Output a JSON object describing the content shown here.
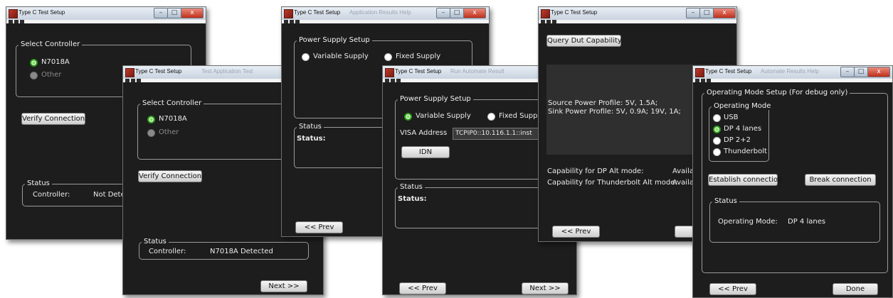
{
  "window_title": "Type C Test Setup",
  "colors": {
    "background": "#1d1d1d",
    "selected_radio": "#2fa51a",
    "titlebar": "#d6dee8"
  },
  "controls": {
    "minimize": "–",
    "maximize": "□",
    "close": "x"
  },
  "w1": {
    "select_legend": "Select Controller",
    "opt_n7018a": "N7018A",
    "opt_other": "Other",
    "verify": "Verify Connection",
    "status_legend": "Status",
    "controller_label": "Controller:",
    "controller_value": "Not Detec"
  },
  "w2": {
    "select_legend": "Select Controller",
    "opt_n7018a": "N7018A",
    "opt_other": "Other",
    "verify": "Verify Connection",
    "status_legend": "Status",
    "controller_label": "Controller:",
    "controller_value": "N7018A Detected",
    "next": "Next >>"
  },
  "w3": {
    "ps_legend": "Power Supply Setup",
    "variable": "Variable Supply",
    "fixed": "Fixed Supply",
    "status_legend": "Status",
    "status_label": "Status:",
    "prev": "<< Prev"
  },
  "w4": {
    "ps_legend": "Power Supply Setup",
    "variable": "Variable Supply",
    "fixed": "Fixed Suppl",
    "visa_label": "VISA Address",
    "visa_value": "TCPIP0::10.116.1.1::inst",
    "idn": "IDN",
    "status_legend": "Status",
    "status_label": "Status:",
    "prev": "<< Prev",
    "next": "Next >>"
  },
  "w5": {
    "query": "Query Dut Capability",
    "source_profile": "Source Power Profile: 5V, 1.5A;",
    "sink_profile": "Sink Power Profile: 5V, 0.9A; 19V, 1A;",
    "dp_label": "Capability for DP Alt mode:",
    "dp_value": "Availa",
    "tb_label": "Capability for Thunderbolt Alt mode:",
    "tb_value": "Availa",
    "prev": "<< Prev",
    "next_partial": "Ne"
  },
  "w6": {
    "setup_legend": "Operating Mode Setup (For debug only)",
    "mode_legend": "Operating Mode",
    "usb": "USB",
    "dp4": "DP 4 lanes",
    "dp22": "DP 2+2",
    "thunderbolt": "Thunderbolt",
    "establish": "Establish connection",
    "break": "Break connection",
    "status_legend": "Status",
    "mode_label": "Operating Mode:",
    "mode_value": "DP 4 lanes",
    "prev": "<< Prev",
    "done": "Done"
  }
}
